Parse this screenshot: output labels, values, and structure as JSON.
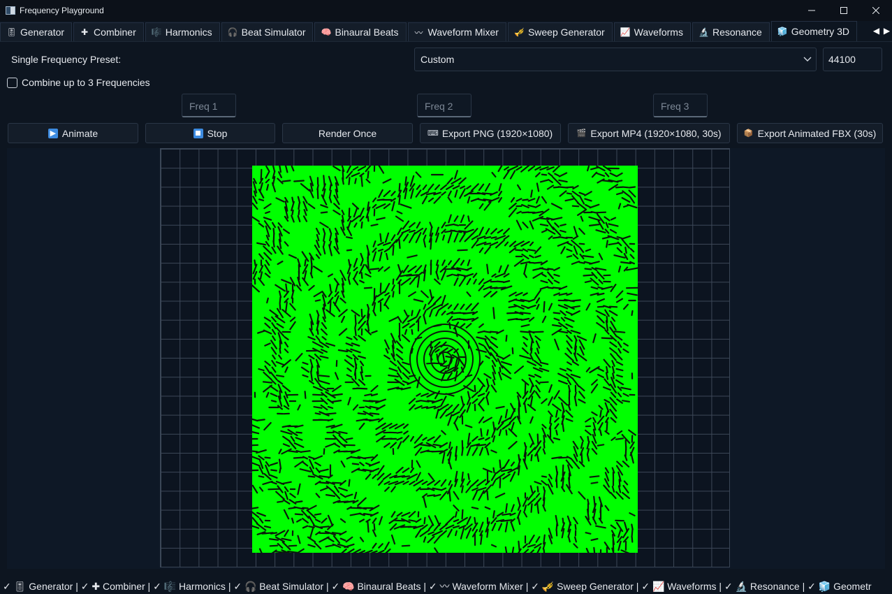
{
  "window": {
    "title": "Frequency Playground",
    "controls": {
      "minimize": "—",
      "maximize": "☐",
      "close": "✕"
    }
  },
  "tabs": [
    {
      "label": "Generator",
      "icon": "🎚",
      "icon_name": "generator-icon"
    },
    {
      "label": "Combiner",
      "icon": "✚",
      "icon_name": "plus-icon"
    },
    {
      "label": "Harmonics",
      "icon": "🎼",
      "icon_name": "harmonics-icon"
    },
    {
      "label": "Beat Simulator",
      "icon": "🎧",
      "icon_name": "headphones-icon"
    },
    {
      "label": "Binaural Beats",
      "icon": "🧠",
      "icon_name": "brain-icon"
    },
    {
      "label": "Waveform Mixer",
      "icon": "〰",
      "icon_name": "wave-mixer-icon"
    },
    {
      "label": "Sweep Generator",
      "icon": "🎺",
      "icon_name": "sweep-icon"
    },
    {
      "label": "Waveforms",
      "icon": "📈",
      "icon_name": "chart-icon"
    },
    {
      "label": "Resonance",
      "icon": "🔬",
      "icon_name": "microscope-icon"
    },
    {
      "label": "Geometry 3D",
      "icon": "🧊",
      "icon_name": "geometry-icon",
      "active": true
    }
  ],
  "tab_scroll": {
    "left": "◀",
    "right": "▶"
  },
  "preset": {
    "label": "Single Frequency Preset:",
    "selected": "Custom",
    "sample_rate": "44100"
  },
  "combine": {
    "label": "Combine up to 3 Frequencies",
    "checked": false
  },
  "freq_inputs": {
    "freq1_placeholder": "Freq 1",
    "freq2_placeholder": "Freq 2",
    "freq3_placeholder": "Freq 3"
  },
  "buttons": {
    "animate": "Animate",
    "stop": "Stop",
    "render_once": "Render Once",
    "export_png": "Export PNG (1920×1080)",
    "export_mp4": "Export MP4 (1920×1080, 30s)",
    "export_fbx": "Export Animated FBX (30s)"
  },
  "colors": {
    "pattern": "#00ff00",
    "background": "#0d1520",
    "grid_line": "#3d4858"
  },
  "statusbar": {
    "text": "✓ 🎚 Generator | ✓ ✚ Combiner | ✓ 🎼 Harmonics | ✓ 🎧 Beat Simulator | ✓ 🧠 Binaural Beats | ✓ 〰 Waveform Mixer | ✓ 🎺 Sweep Generator | ✓ 📈 Waveforms | ✓ 🔬 Resonance | ✓ 🧊 Geometr"
  }
}
